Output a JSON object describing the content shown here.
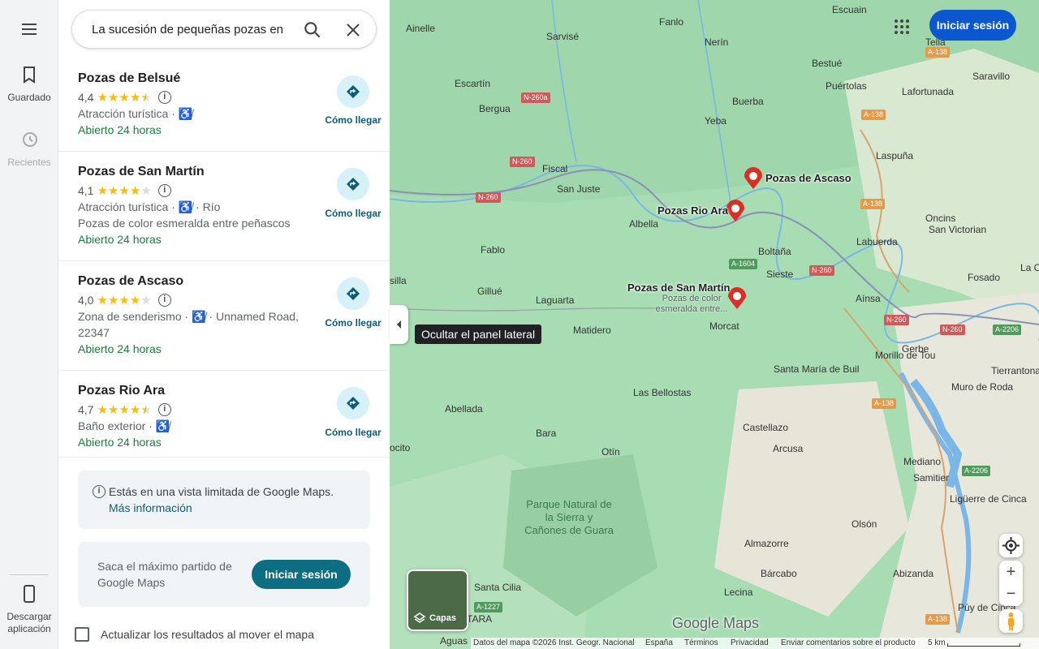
{
  "rail": {
    "saved_label": "Guardado",
    "recents_label": "Recientes",
    "download_label": "Descargar aplicación"
  },
  "search": {
    "value": "La sucesión de pequeñas pozas en"
  },
  "results": [
    {
      "name": "Pozas de Belsué",
      "rating": "4,4",
      "stars": 4.4,
      "category": "Atracción turística",
      "extra": "",
      "desc": "",
      "hours": "Abierto 24 horas",
      "directions": "Cómo llegar"
    },
    {
      "name": "Pozas de San Martín",
      "rating": "4,1",
      "stars": 4.1,
      "category": "Atracción turística",
      "extra": "Río",
      "desc": "Pozas de color esmeralda entre peñascos",
      "hours": "Abierto 24 horas",
      "directions": "Cómo llegar"
    },
    {
      "name": "Pozas de Ascaso",
      "rating": "4,0",
      "stars": 4.0,
      "category": "Zona de senderismo",
      "extra": "Unnamed Road,",
      "desc": "22347",
      "hours": "Abierto 24 horas",
      "directions": "Cómo llegar"
    },
    {
      "name": "Pozas Rio Ara",
      "rating": "4,7",
      "stars": 4.7,
      "category": "Baño exterior",
      "extra": "",
      "desc": "",
      "hours": "Abierto 24 horas",
      "directions": "Cómo llegar"
    }
  ],
  "limited": {
    "text": "Estás en una vista limitada de Google Maps.",
    "link": "Más información"
  },
  "promo": {
    "text": "Saca el máximo partido de Google Maps",
    "button": "Iniciar sesión"
  },
  "update_checkbox": {
    "label": "Actualizar los resultados al mover el mapa",
    "checked": false
  },
  "map": {
    "signin": "Iniciar sesión",
    "tooltip": "Ocultar el panel lateral",
    "layers_label": "Capas",
    "logo": "Google Maps",
    "footer": {
      "data": "Datos del mapa ©2026 Inst. Geogr. Nacional",
      "country": "España",
      "terms": "Términos",
      "privacy": "Privacidad",
      "feedback": "Enviar comentarios sobre el producto",
      "scale": "5 km"
    },
    "pins": [
      {
        "name": "Pozas de Ascaso",
        "sub": ""
      },
      {
        "name": "Pozas Rio Ara",
        "sub": ""
      },
      {
        "name": "Pozas de San Martín",
        "sub": "Pozas de color esmeralda entre..."
      }
    ],
    "places": [
      "Escuain",
      "Ainelle",
      "Fanlo",
      "Sarvisé",
      "Nerín",
      "Tella",
      "Bestué",
      "Saravillo",
      "Escartín",
      "Puértolas",
      "Lafortunada",
      "Bergua",
      "Buerba",
      "Yeba",
      "Laspuña",
      "Fiscal",
      "San Juste",
      "Albella",
      "Oncins",
      "San Victorian",
      "Labuerda",
      "Boltaña",
      "Fablo",
      "Sieste",
      "La C",
      "Fosado",
      "silla",
      "Gillué",
      "Laguarta",
      "Aínsa",
      "Matidero",
      "Morcat",
      "Gerbe",
      "Morillo de Tou",
      "Tierrantona",
      "Santa María de Buil",
      "Muro de Roda",
      "Las Bellostas",
      "Abellada",
      "Bara",
      "Castellazo",
      "Otín",
      "Arcusa",
      "Mediano",
      "Samitier",
      "Ligüerre de Cinca",
      "ocito",
      "Parque Natural de la Sierra y Cañones de Guara",
      "Olsón",
      "Almazorre",
      "Bárcabo",
      "Abizanda",
      "Santa Cilia",
      "Lecina",
      "Púy de Cinca",
      "BASTARA",
      "Aguas",
      "Sarvise"
    ],
    "roads": [
      "N-260a",
      "N-260",
      "N-260",
      "A-138",
      "A-138",
      "A-138",
      "A-1604",
      "N-260",
      "N-260",
      "N-260",
      "A-2206",
      "A-138",
      "A-2206",
      "A-1227",
      "A-138"
    ],
    "colors": {
      "terrain": "#a8ddb3",
      "river": "#7ab6e6",
      "accent": "#0b57d0",
      "pin": "#d93025"
    }
  }
}
